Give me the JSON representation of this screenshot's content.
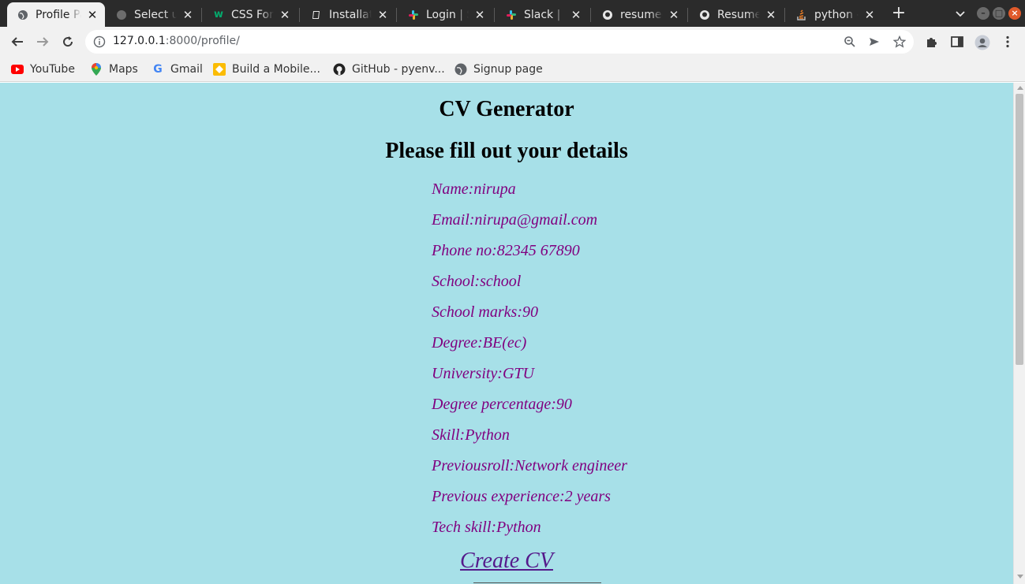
{
  "tabs": [
    {
      "label": "Profile Page",
      "icon": "globe-icon",
      "active": true
    },
    {
      "label": "Select user",
      "icon": "globe-icon"
    },
    {
      "label": "CSS Fonts",
      "icon": "w3schools-icon"
    },
    {
      "label": "Installation",
      "icon": "book-icon"
    },
    {
      "label": "Login | Slack",
      "icon": "slack-icon"
    },
    {
      "label": "Slack | Kod",
      "icon": "slack-icon"
    },
    {
      "label": "resume-builder",
      "icon": "github-icon"
    },
    {
      "label": "Resume",
      "icon": "github-icon"
    },
    {
      "label": "python -",
      "icon": "stackoverflow-icon"
    }
  ],
  "address": {
    "host": "127.0.0.1",
    "rest": ":8000/profile/"
  },
  "bookmarks": [
    {
      "label": "YouTube",
      "icon": "youtube-icon"
    },
    {
      "label": "Maps",
      "icon": "maps-icon"
    },
    {
      "label": "Gmail",
      "icon": "google-icon"
    },
    {
      "label": "Build a Mobile...",
      "icon": "bookmark-app-icon"
    },
    {
      "label": "GitHub - pyenv...",
      "icon": "github-icon"
    },
    {
      "label": "Signup page",
      "icon": "globe-icon"
    }
  ],
  "page": {
    "title": "CV Generator",
    "subtitle": "Please fill out your details",
    "details": [
      "Name:nirupa",
      "Email:nirupa@gmail.com",
      "Phone no:82345 67890",
      "School:school",
      "School marks:90",
      "Degree:BE(ec)",
      "University:GTU",
      "Degree percentage:90",
      "Skill:Python",
      "Previousroll:Network engineer",
      "Previous experience:2 years",
      "Tech skill:Python"
    ],
    "create_cv_label": "Create CV"
  },
  "colors": {
    "page_background": "#a7e0e8",
    "detail_text": "#800080",
    "link": "#551a8b",
    "tabstrip": "#2b2b2b"
  }
}
